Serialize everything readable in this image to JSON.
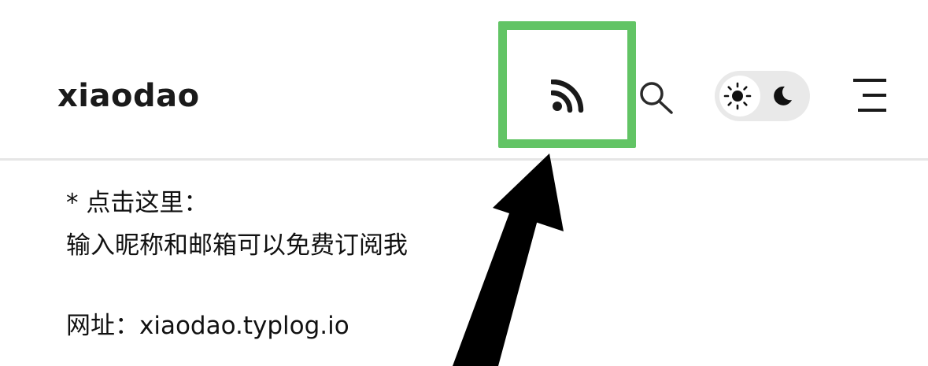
{
  "header": {
    "site_title": "xiaodao"
  },
  "icons": {
    "rss": "rss-icon",
    "search": "search-icon",
    "sun": "sun-icon",
    "moon": "moon-icon",
    "menu": "menu-icon",
    "arrow": "arrow-annotation"
  },
  "content": {
    "line1": "* 点击这里：",
    "line2": "输入昵称和邮箱可以免费订阅我",
    "line3": "网址：xiaodao.typlog.io"
  },
  "colors": {
    "highlight": "#62c465",
    "text": "#111111",
    "toggle_bg": "#e9e9e9",
    "divider": "#e6e6e6"
  }
}
